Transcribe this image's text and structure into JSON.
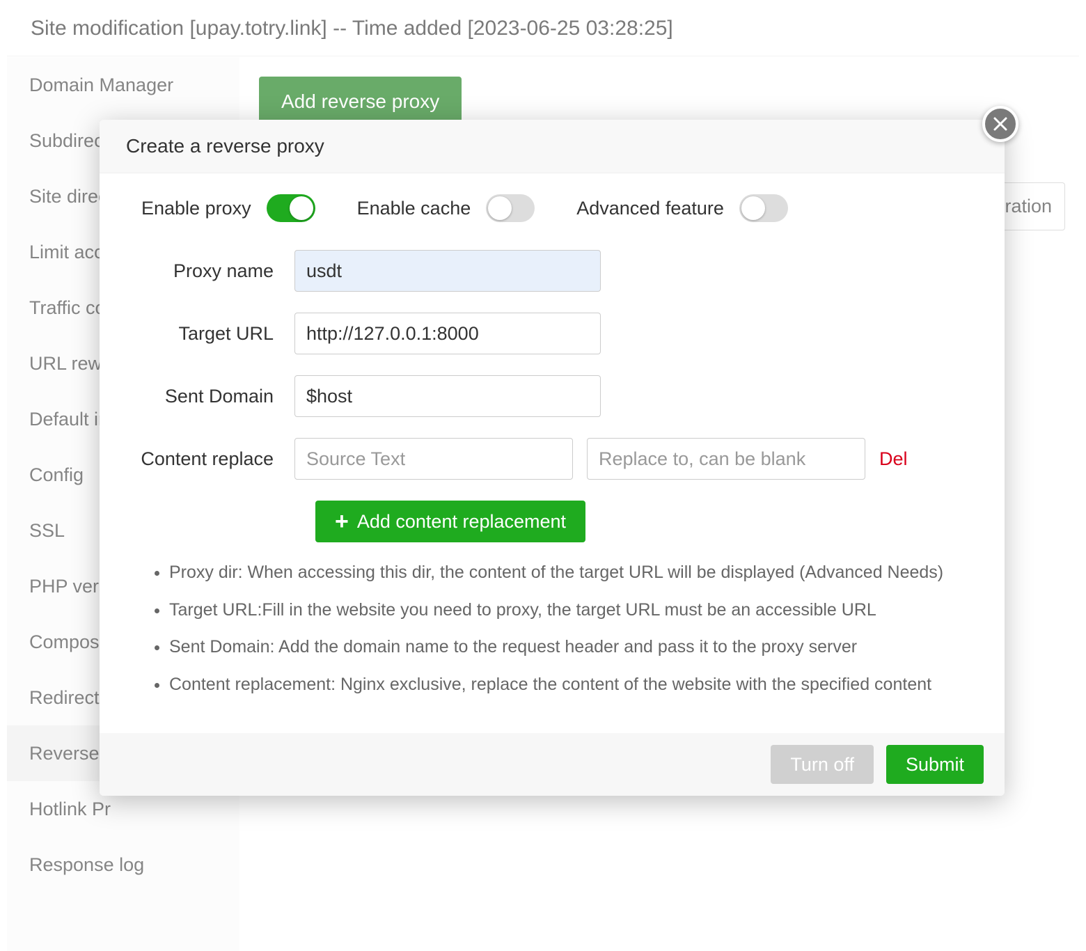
{
  "header": {
    "title": "Site modification [upay.totry.link] -- Time added [2023-06-25 03:28:25]"
  },
  "sidebar": {
    "items": [
      "Domain Manager",
      "Subdirect",
      "Site direc",
      "Limit acce",
      "Traffic co",
      "URL rewr",
      "Default in",
      "Config",
      "SSL",
      "PHP vers",
      "Compose",
      "Redirect",
      "Reverse p",
      "Hotlink Pr",
      "Response log"
    ],
    "active_index": 12
  },
  "main": {
    "add_proxy_button": "Add reverse proxy",
    "table_operation_header": "eration"
  },
  "modal": {
    "title": "Create a reverse proxy",
    "toggles": {
      "enable_proxy": {
        "label": "Enable proxy",
        "on": true
      },
      "enable_cache": {
        "label": "Enable cache",
        "on": false
      },
      "advanced_feature": {
        "label": "Advanced feature",
        "on": false
      }
    },
    "fields": {
      "proxy_name": {
        "label": "Proxy name",
        "value": "usdt"
      },
      "target_url": {
        "label": "Target URL",
        "value": "http://127.0.0.1:8000"
      },
      "sent_domain": {
        "label": "Sent Domain",
        "value": "$host"
      },
      "content_replace": {
        "label": "Content replace",
        "source_placeholder": "Source Text",
        "replace_placeholder": "Replace to, can be blank",
        "del_label": "Del"
      }
    },
    "add_content_button": "Add content replacement",
    "notes": [
      "Proxy dir: When accessing this dir, the content of the target URL will be displayed (Advanced Needs)",
      "Target URL:Fill in the website you need to proxy, the target URL must be an accessible URL",
      "Sent Domain: Add the domain name to the request header and pass it to the proxy server",
      "Content replacement: Nginx exclusive, replace the content of the website with the specified content"
    ],
    "footer": {
      "turn_off": "Turn off",
      "submit": "Submit"
    }
  }
}
